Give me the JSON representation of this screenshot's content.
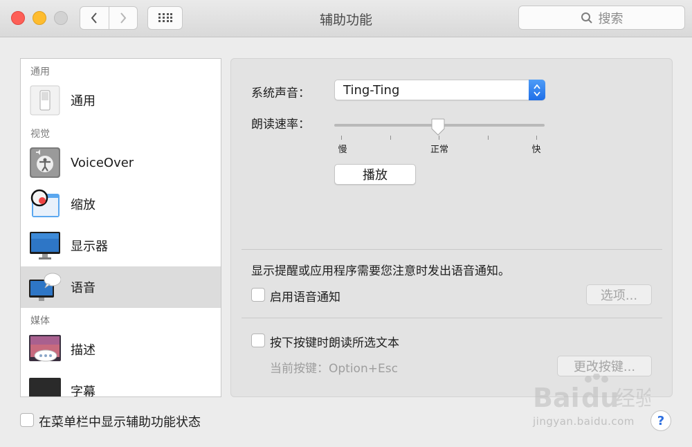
{
  "window": {
    "title": "辅助功能"
  },
  "toolbar": {
    "back_icon": "chevron-left-icon",
    "forward_icon": "chevron-right-icon",
    "grid_icon": "grid-icon",
    "search_placeholder": "搜索"
  },
  "sidebar": {
    "sections": [
      {
        "header": "通用",
        "items": [
          {
            "label": "通用",
            "icon": "switch-icon"
          }
        ]
      },
      {
        "header": "视觉",
        "items": [
          {
            "label": "VoiceOver",
            "icon": "voiceover-icon"
          },
          {
            "label": "缩放",
            "icon": "zoom-icon"
          },
          {
            "label": "显示器",
            "icon": "display-icon"
          },
          {
            "label": "语音",
            "icon": "speech-icon",
            "selected": true
          }
        ]
      },
      {
        "header": "媒体",
        "items": [
          {
            "label": "描述",
            "icon": "descriptions-icon"
          },
          {
            "label": "字幕",
            "icon": "captions-icon"
          }
        ]
      }
    ]
  },
  "speech": {
    "system_voice_label": "系统声音：",
    "system_voice_value": "Ting-Ting",
    "rate_label": "朗读速率：",
    "rate_slow": "慢",
    "rate_normal": "正常",
    "rate_fast": "快",
    "rate_value": 0.5,
    "play_button": "播放",
    "announce_description": "显示提醒或应用程序需要您注意时发出语音通知。",
    "enable_announcements_label": "启用语音通知",
    "enable_announcements_checked": false,
    "options_button": "选项...",
    "speak_selected_label": "按下按键时朗读所选文本",
    "speak_selected_checked": false,
    "current_key_label": "当前按键：Option+Esc",
    "change_key_button": "更改按键..."
  },
  "footer": {
    "menubar_status_label": "在菜单栏中显示辅助功能状态",
    "menubar_status_checked": false,
    "help_label": "?"
  },
  "watermark": {
    "text": "jingyan.baidu.com"
  },
  "colors": {
    "accent": "#1f6fe8",
    "selected_row": "#dcdcdc",
    "close": "#fd5f57",
    "minimize": "#febc2e"
  }
}
